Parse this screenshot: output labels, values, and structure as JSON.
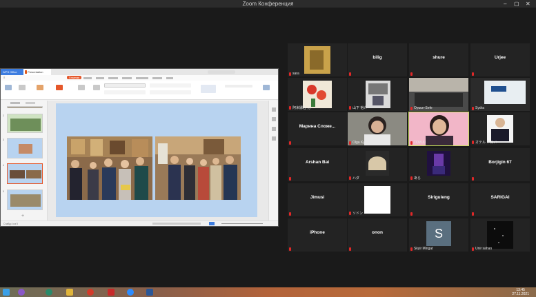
{
  "window": {
    "title": "Zoom Конференция"
  },
  "presentation": {
    "app_tab": "WPS Office",
    "doc_tab": "Presentation",
    "active_menu": "Главная",
    "slide_count_status": "Слайд 4 из 5"
  },
  "participants": [
    {
      "name": "sara",
      "kind": "photo"
    },
    {
      "name": "bilig",
      "kind": "name"
    },
    {
      "name": "shure",
      "kind": "name"
    },
    {
      "name": "Urjee",
      "kind": "name"
    },
    {
      "name": "阿米娜娃 分",
      "kind": "photo"
    },
    {
      "name": "山下 裕介",
      "kind": "photo"
    },
    {
      "name": "Oyuun-Sefe",
      "kind": "photo"
    },
    {
      "name": "Sydra",
      "kind": "photo"
    },
    {
      "name": "Марина Сложе...",
      "kind": "name"
    },
    {
      "name": "Olga Kyllonen",
      "kind": "video"
    },
    {
      "name": "TOVUU",
      "kind": "video"
    },
    {
      "name": "オテル ドロメ",
      "kind": "video"
    },
    {
      "name": "Arshan Bai",
      "kind": "name"
    },
    {
      "name": "ハダ",
      "kind": "photo"
    },
    {
      "name": "あら",
      "kind": "photo"
    },
    {
      "name": "Borjigin 67",
      "kind": "name"
    },
    {
      "name": "Jimusi",
      "kind": "name"
    },
    {
      "name": "ソドン",
      "kind": "photo"
    },
    {
      "name": "Siriguleng",
      "kind": "name"
    },
    {
      "name": "SARIGAI",
      "kind": "name"
    },
    {
      "name": "iPhone",
      "kind": "name"
    },
    {
      "name": "onon",
      "kind": "name"
    },
    {
      "name": "Skyir Mingat",
      "kind": "avatar",
      "initial": "S"
    },
    {
      "name": "Unir sahan",
      "kind": "photo"
    }
  ],
  "taskbar": {
    "time": "13:45",
    "date": "27.11.2021"
  }
}
